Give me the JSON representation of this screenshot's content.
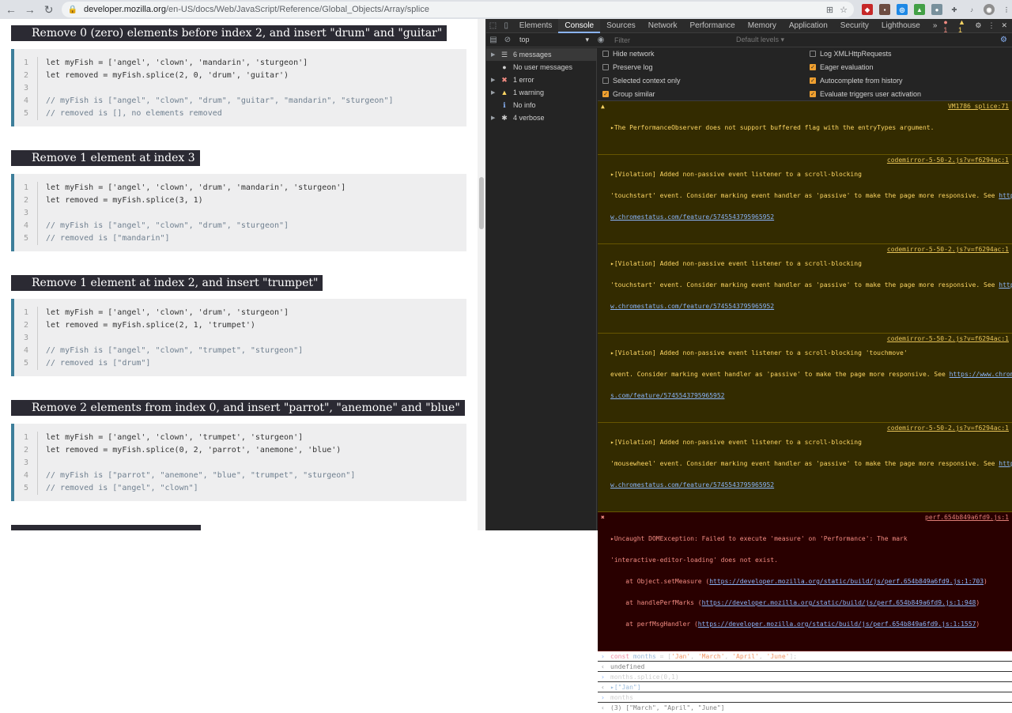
{
  "browser": {
    "url_host": "developer.mozilla.org",
    "url_path": "/en-US/docs/Web/JavaScript/Reference/Global_Objects/Array/splice"
  },
  "page": {
    "sections": [
      {
        "title": "Remove 0 (zero) elements before index 2, and insert \"drum\" and \"guitar\"",
        "lines": [
          {
            "n": "1",
            "text": "let myFish = ['angel', 'clown', 'mandarin', 'sturgeon']"
          },
          {
            "n": "2",
            "text": "let removed = myFish.splice(2, 0, 'drum', 'guitar')"
          },
          {
            "n": "3",
            "text": ""
          },
          {
            "n": "4",
            "text": "// myFish is [\"angel\", \"clown\", \"drum\", \"guitar\", \"mandarin\", \"sturgeon\"]"
          },
          {
            "n": "5",
            "text": "// removed is [], no elements removed"
          }
        ]
      },
      {
        "title": "Remove 1 element at index 3",
        "lines": [
          {
            "n": "1",
            "text": "let myFish = ['angel', 'clown', 'drum', 'mandarin', 'sturgeon']"
          },
          {
            "n": "2",
            "text": "let removed = myFish.splice(3, 1)"
          },
          {
            "n": "3",
            "text": ""
          },
          {
            "n": "4",
            "text": "// myFish is [\"angel\", \"clown\", \"drum\", \"sturgeon\"]"
          },
          {
            "n": "5",
            "text": "// removed is [\"mandarin\"]"
          }
        ]
      },
      {
        "title": "Remove 1 element at index 2, and insert \"trumpet\"",
        "lines": [
          {
            "n": "1",
            "text": "let myFish = ['angel', 'clown', 'drum', 'sturgeon']"
          },
          {
            "n": "2",
            "text": "let removed = myFish.splice(2, 1, 'trumpet')"
          },
          {
            "n": "3",
            "text": ""
          },
          {
            "n": "4",
            "text": "// myFish is [\"angel\", \"clown\", \"trumpet\", \"sturgeon\"]"
          },
          {
            "n": "5",
            "text": "// removed is [\"drum\"]"
          }
        ]
      },
      {
        "title": "Remove 2 elements from index 0, and insert \"parrot\", \"anemone\" and \"blue\"",
        "lines": [
          {
            "n": "1",
            "text": "let myFish = ['angel', 'clown', 'trumpet', 'sturgeon']"
          },
          {
            "n": "2",
            "text": "let removed = myFish.splice(0, 2, 'parrot', 'anemone', 'blue')"
          },
          {
            "n": "3",
            "text": ""
          },
          {
            "n": "4",
            "text": "// myFish is [\"parrot\", \"anemone\", \"blue\", \"trumpet\", \"sturgeon\"]"
          },
          {
            "n": "5",
            "text": "// removed is [\"angel\", \"clown\"]"
          }
        ]
      }
    ]
  },
  "devtools": {
    "tabs": [
      "Elements",
      "Console",
      "Sources",
      "Network",
      "Performance",
      "Memory",
      "Application",
      "Security",
      "Lighthouse"
    ],
    "active_tab": "Console",
    "more_tabs": "»",
    "error_count": "1",
    "warning_count": "1",
    "context": "top",
    "filter_placeholder": "Filter",
    "levels": "Default levels ▾",
    "sidebar": [
      {
        "label": "6 messages",
        "icon": "list-icon"
      },
      {
        "label": "No user messages",
        "icon": "user-icon"
      },
      {
        "label": "1 error",
        "icon": "error-icon"
      },
      {
        "label": "1 warning",
        "icon": "warning-icon"
      },
      {
        "label": "No info",
        "icon": "info-icon"
      },
      {
        "label": "4 verbose",
        "icon": "bug-icon"
      }
    ],
    "settings_left": [
      {
        "label": "Hide network",
        "checked": false
      },
      {
        "label": "Preserve log",
        "checked": false
      },
      {
        "label": "Selected context only",
        "checked": false
      },
      {
        "label": "Group similar",
        "checked": true
      }
    ],
    "settings_right": [
      {
        "label": "Log XMLHttpRequests",
        "checked": false
      },
      {
        "label": "Eager evaluation",
        "checked": true
      },
      {
        "label": "Autocomplete from history",
        "checked": true
      },
      {
        "label": "Evaluate triggers user activation",
        "checked": true
      }
    ],
    "messages": {
      "warn0_text": "The PerformanceObserver does not support buffered flag with the entryTypes argument.",
      "warn0_src": "VM1786 splice:71",
      "v1_l1": "▸[Violation] Added non-passive event listener to a scroll-blocking",
      "v1_l2": "'touchstart' event. Consider marking event handler as 'passive' to make the page more responsive. See ",
      "v1_link1": "https://ww",
      "v1_link2": "w.chromestatus.com/feature/5745543795965952",
      "v1_src": "codemirror-5-50-2.js?v=f6294ac:1",
      "v2_l1": "▸[Violation] Added non-passive event listener to a scroll-blocking",
      "v2_l2": "'touchstart' event. Consider marking event handler as 'passive' to make the page more responsive. See ",
      "v2_link1": "https://ww",
      "v2_link2": "w.chromestatus.com/feature/5745543795965952",
      "v2_src": "codemirror-5-50-2.js?v=f6294ac:1",
      "v3_l1": "▸[Violation] Added non-passive event listener to a scroll-blocking 'touchmove'",
      "v3_l2": "event. Consider marking event handler as 'passive' to make the page more responsive. See ",
      "v3_link1": "https://www.chromestatu",
      "v3_link2": "s.com/feature/5745543795965952",
      "v3_src": "codemirror-5-50-2.js?v=f6294ac:1",
      "v4_l1": "▸[Violation] Added non-passive event listener to a scroll-blocking",
      "v4_l2": "'mousewheel' event. Consider marking event handler as 'passive' to make the page more responsive. See ",
      "v4_link1": "https://ww",
      "v4_link2": "w.chromestatus.com/feature/5745543795965952",
      "v4_src": "codemirror-5-50-2.js?v=f6294ac:1",
      "err_l1": "▸Uncaught DOMException: Failed to execute 'measure' on 'Performance': The mark",
      "err_l2": "'interactive-editor-loading' does not exist.",
      "err_src": "perf.654b849a6fd9.js:1",
      "err_s1_pre": "    at Object.setMeasure (",
      "err_s1_link": "https://developer.mozilla.org/static/build/js/perf.654b849a6fd9.js:1:703",
      "err_s2_pre": "    at handlePerfMarks (",
      "err_s2_link": "https://developer.mozilla.org/static/build/js/perf.654b849a6fd9.js:1:948",
      "err_s3_pre": "    at perfMsgHandler (",
      "err_s3_link": "https://developer.mozilla.org/static/build/js/perf.654b849a6fd9.js:1:1557",
      "close_paren": ")"
    },
    "console": {
      "in1_kw": "const",
      "in1_var": "months",
      "in1_rest_pre": " = [",
      "in1_s1": "'Jan'",
      "in1_s2": "'March'",
      "in1_s3": "'April'",
      "in1_s4": "'June'",
      "in1_end": "];",
      "comma": ", ",
      "out1": "undefined",
      "in2": "months.splice(0,1)",
      "out2": "▸[\"Jan\"]",
      "in3": "months",
      "out3_count": "(3) ",
      "out3_vals": "[\"March\", \"April\", \"June\"]"
    }
  }
}
